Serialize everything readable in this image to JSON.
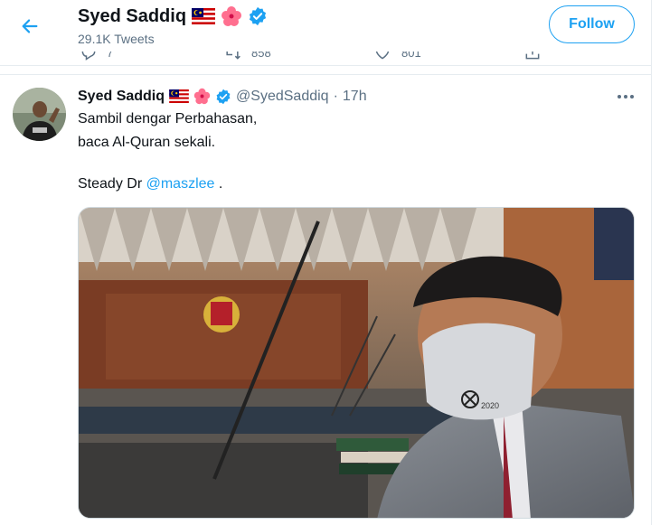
{
  "header": {
    "back_icon": "arrow-left-icon",
    "name": "Syed Saddiq",
    "badges": [
      "malaysia-flag-icon",
      "hibiscus-icon",
      "verified-badge-icon"
    ],
    "tweet_count": "29.1K Tweets",
    "follow_label": "Follow"
  },
  "prev_tweet_actions": [
    {
      "icon": "reply-icon",
      "count": "7"
    },
    {
      "icon": "retweet-icon",
      "count": "858"
    },
    {
      "icon": "like-icon",
      "count": "801"
    },
    {
      "icon": "share-icon",
      "count": ""
    }
  ],
  "tweet": {
    "name": "Syed Saddiq",
    "handle": "@SyedSaddiq",
    "separator": "·",
    "time": "17h",
    "line1": "Sambil dengar Perbahasan,",
    "line2": "baca Al-Quran sekali.",
    "line3_prefix": "Steady Dr ",
    "mention": "@maszlee",
    "line3_suffix": " .",
    "mask_print": "2020"
  },
  "colors": {
    "accent": "#1da1f2",
    "secondary_text": "#5b7083",
    "border": "#e6ecf0"
  }
}
